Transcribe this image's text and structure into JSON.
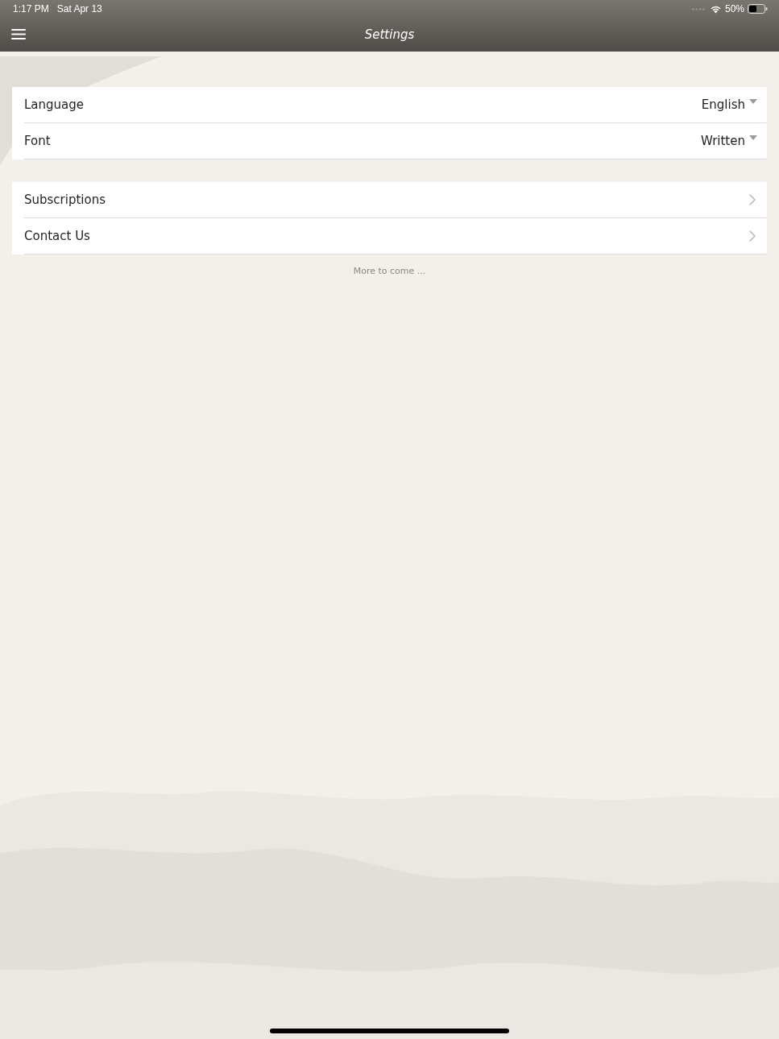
{
  "status_bar": {
    "time": "1:17 PM",
    "date": "Sat Apr 13",
    "battery": "50%"
  },
  "nav_bar": {
    "title": "Settings"
  },
  "groups": [
    {
      "rows": [
        {
          "kind": "dropdown",
          "label": "Language",
          "value": "English"
        },
        {
          "kind": "dropdown",
          "label": "Font",
          "value": "Written"
        }
      ]
    },
    {
      "rows": [
        {
          "kind": "link",
          "label": "Subscriptions"
        },
        {
          "kind": "link",
          "label": "Contact Us"
        }
      ]
    }
  ],
  "footer_note": "More to come ..."
}
